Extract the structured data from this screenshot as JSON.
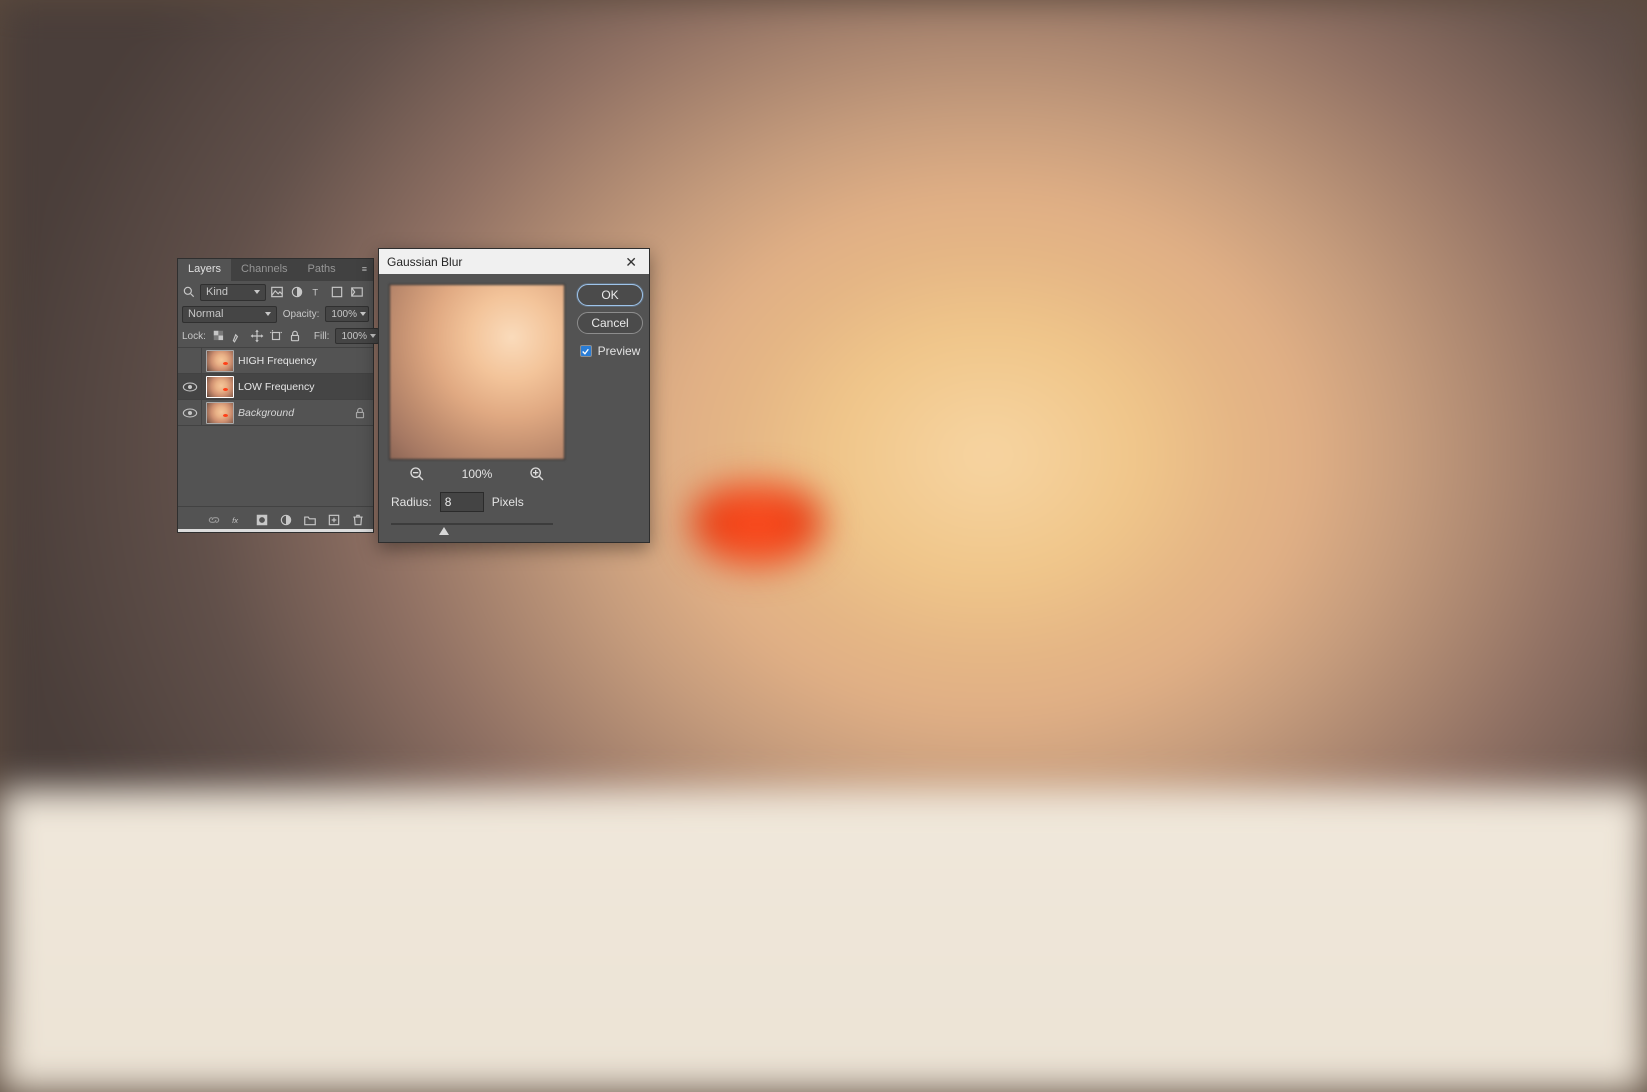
{
  "panel": {
    "tabs": [
      "Layers",
      "Channels",
      "Paths"
    ],
    "active_tab": "Layers",
    "kind_label": "Kind",
    "blend_mode": "Normal",
    "opacity_label": "Opacity:",
    "opacity_value": "100%",
    "lock_label": "Lock:",
    "fill_label": "Fill:",
    "fill_value": "100%",
    "layers": [
      {
        "name": "HIGH Frequency",
        "visible": false,
        "selected": false,
        "italic": false,
        "locked": false
      },
      {
        "name": "LOW Frequency",
        "visible": true,
        "selected": true,
        "italic": false,
        "locked": false
      },
      {
        "name": "Background",
        "visible": true,
        "selected": false,
        "italic": true,
        "locked": true
      }
    ]
  },
  "dialog": {
    "title": "Gaussian Blur",
    "ok": "OK",
    "cancel": "Cancel",
    "preview_label": "Preview",
    "preview_checked": true,
    "zoom": "100%",
    "radius_label": "Radius:",
    "radius_value": "8",
    "radius_unit": "Pixels"
  }
}
